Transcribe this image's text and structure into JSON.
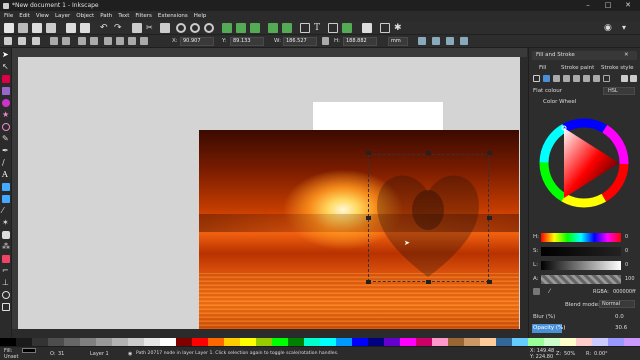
{
  "window": {
    "title": "*New document 1 - Inkscape"
  },
  "menu": [
    "File",
    "Edit",
    "View",
    "Layer",
    "Object",
    "Path",
    "Text",
    "Filters",
    "Extensions",
    "Help"
  ],
  "controls": {
    "x_label": "X:",
    "x_value": "90.907",
    "y_label": "Y:",
    "y_value": "89.133",
    "w_label": "W:",
    "w_value": "186.527",
    "h_label": "H:",
    "h_value": "188.882",
    "unit": "mm"
  },
  "panel": {
    "title": "Fill and Stroke",
    "fill_tab": "Fill",
    "stroke_paint_tab": "Stroke paint",
    "stroke_style_tab": "Stroke style",
    "paint_mode": "Flat colour",
    "color_mode": "HSL",
    "color_wheel_label": "Color Wheel",
    "h_label": "H:",
    "h_value": "0",
    "s_label": "S:",
    "s_value": "0",
    "l_label": "L:",
    "l_value": "0",
    "a_label": "A:",
    "a_value": "100",
    "rgba_label": "RGBA:",
    "rgba_value": "000000ff",
    "blend_label": "Blend mode:",
    "blend_value": "Normal",
    "blur_label": "Blur (%)",
    "blur_value": "0.0",
    "opacity_label": "Opacity (%)",
    "opacity_value": "30.6"
  },
  "status": {
    "fill_label": "Fill:",
    "fill_value": "Unset",
    "opacity_label": "O:",
    "opacity_value": "31",
    "layer_name": "Layer 1",
    "message": "Path 20717 node in layer Layer 1. Click selection again to toggle scale/rotation handles.",
    "x_coord": "X: 149.48",
    "y_coord": "Y: 224.80",
    "zoom_label": "Z:",
    "zoom_value": "50%",
    "rot_label": "R:",
    "rot_value": "0.00°"
  },
  "colors": {
    "accent": "#4a90d9",
    "palette": [
      "#000000",
      "#1a1a1a",
      "#333333",
      "#4d4d4d",
      "#666666",
      "#808080",
      "#999999",
      "#b3b3b3",
      "#cccccc",
      "#e6e6e6",
      "#ffffff",
      "#800000",
      "#ff0000",
      "#ff6600",
      "#ffcc00",
      "#ffff00",
      "#99cc00",
      "#00ff00",
      "#008000",
      "#00ffcc",
      "#00ffff",
      "#0099ff",
      "#0000ff",
      "#000080",
      "#6600cc",
      "#ff00ff",
      "#cc0066",
      "#ff99cc",
      "#996633",
      "#cc9966",
      "#ffcc99",
      "#336699",
      "#66ccff",
      "#99ff99",
      "#ccffcc",
      "#ffffcc",
      "#ffcccc",
      "#ccccff",
      "#9999ff",
      "#cc99ff"
    ]
  }
}
